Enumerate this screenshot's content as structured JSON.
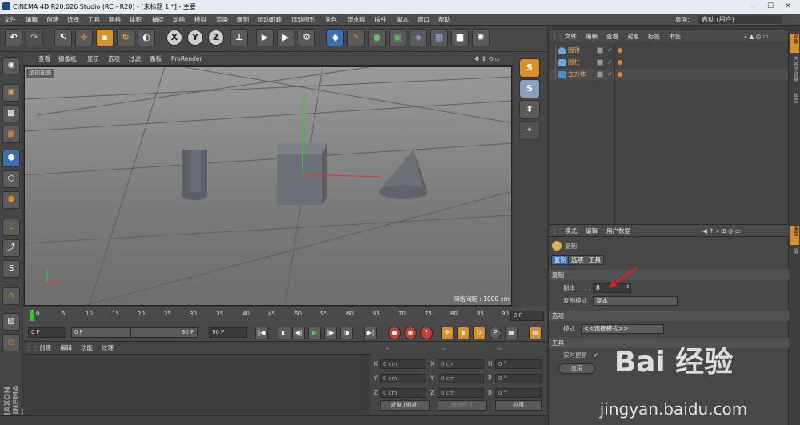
{
  "titlebar": {
    "title": "CINEMA 4D R20.026 Studio (RC - R20) - [未标题 1 *] - 主要",
    "min": "—",
    "max": "☐",
    "close": "✕"
  },
  "menubar": {
    "items": [
      "文件",
      "编辑",
      "创建",
      "选择",
      "工具",
      "网格",
      "体积",
      "捕捉",
      "动画",
      "模拟",
      "渲染",
      "雕刻",
      "运动跟踪",
      "运动图形",
      "角色",
      "流水线",
      "插件",
      "脚本",
      "窗口",
      "帮助"
    ],
    "layout_label": "界面:",
    "layout_value": "启动 (用户)"
  },
  "toolbar": {
    "axis": [
      "X",
      "Y",
      "Z"
    ]
  },
  "viewport": {
    "menu": [
      "查看",
      "摄像机",
      "显示",
      "选项",
      "过滤",
      "面板",
      "ProRender"
    ],
    "label": "透视视图",
    "grid_distance": "网格间距 : 1000 cm",
    "colors": {
      "x_axis": "#d43c3c",
      "y_axis": "#3cc23c"
    }
  },
  "timeline": {
    "ticks": [
      "0",
      "5",
      "10",
      "15",
      "20",
      "25",
      "30",
      "35",
      "40",
      "45",
      "50",
      "55",
      "60",
      "65",
      "70",
      "75",
      "80",
      "85",
      "90"
    ],
    "current_frame": "0 F"
  },
  "transport": {
    "start": "0 F",
    "range_start": "0 F",
    "range_end": "90 F",
    "end": "90 F"
  },
  "material": {
    "menu": [
      "创建",
      "编辑",
      "功能",
      "纹理"
    ]
  },
  "coords": {
    "headers": [
      "--",
      "--",
      "--"
    ],
    "rows": [
      {
        "l1": "X",
        "v1": "0 cm",
        "l2": "X",
        "v2": "0 cm",
        "l3": "H",
        "v3": "0 °"
      },
      {
        "l1": "Y",
        "v1": "0 cm",
        "l2": "Y",
        "v2": "0 cm",
        "l3": "P",
        "v3": "0 °"
      },
      {
        "l1": "Z",
        "v1": "0 cm",
        "l2": "Z",
        "v2": "0 cm",
        "l3": "B",
        "v3": "0 °"
      }
    ],
    "mode": "对象 (相对)",
    "size_mode": "绝对尺寸",
    "apply": "应用"
  },
  "objects": {
    "menu": [
      "文件",
      "编辑",
      "查看",
      "对象",
      "标签",
      "书签"
    ],
    "list": [
      {
        "name": "圆锥"
      },
      {
        "name": "圆柱"
      },
      {
        "name": "立方体"
      }
    ]
  },
  "sidetabs": [
    "对象",
    "内容浏览器",
    "构造",
    "属性",
    "层"
  ],
  "attributes": {
    "menu": [
      "模式",
      "编辑",
      "用户数据"
    ],
    "object_name": "复制",
    "tabs": [
      "复制",
      "选项",
      "工具"
    ],
    "section_copy": "复制",
    "copies_label": "副本 . . . .",
    "copies_value": "8",
    "copy_mode_label": "复制模式",
    "copy_mode_value": "复本",
    "section_options": "选项",
    "mode_label": "模式",
    "mode_value": "<<选择模式>>",
    "section_tool": "工具",
    "realtime_label": "实时更新",
    "realtime_checked": "✓",
    "apply_button": "应用"
  },
  "watermark": {
    "logo": "Bai 经验",
    "url": "jingyan.baidu.com"
  }
}
